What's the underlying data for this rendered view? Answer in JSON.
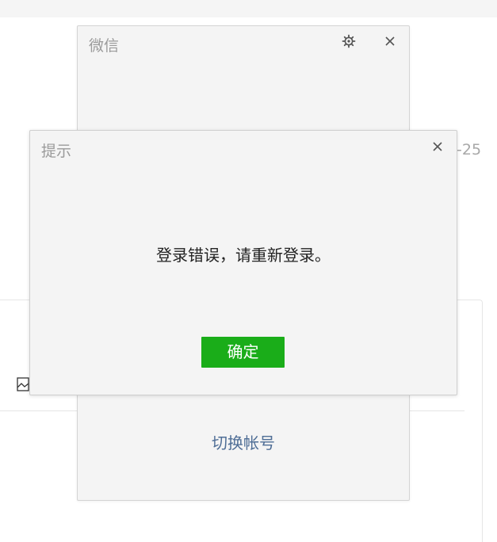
{
  "background": {
    "partial_text": "-25"
  },
  "wechat_window": {
    "title": "微信",
    "switch_account_label": "切换帐号",
    "icons": {
      "settings": "gear-icon",
      "close": "close-icon"
    }
  },
  "prompt_dialog": {
    "title": "提示",
    "message": "登录错误，请重新登录。",
    "confirm_label": "确定",
    "icons": {
      "close": "close-icon"
    }
  },
  "colors": {
    "confirm_button": "#1aad19",
    "link": "#4f6e96",
    "title_text": "#9a9a9a",
    "window_bg": "#f4f4f4"
  }
}
